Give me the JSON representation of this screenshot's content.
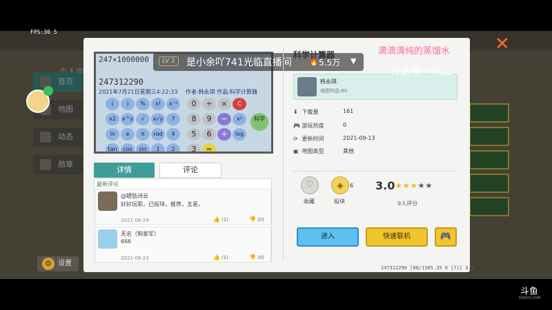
{
  "overlay": {
    "fps": "FPS:30 5",
    "stream": {
      "level": "LV 2",
      "streamer": "是小余吖741光临直播间",
      "viewers": "5.5万"
    },
    "danmu": [
      "滴滴清纯的蒸馏水",
      "在这能一元二"
    ],
    "watermark": "斗鱼",
    "watermark_sub": "DOUYU.COM"
  },
  "background": {
    "panel_title": "个人中心",
    "sidebar": [
      {
        "label": "首页"
      },
      {
        "label": "地图"
      },
      {
        "label": "动态"
      },
      {
        "label": "勋章"
      }
    ],
    "settings_label": "设置"
  },
  "preview": {
    "expr": "247×1000000",
    "result": "247312290",
    "date": "2021年7月21日星期三4:22:33",
    "authors": "作者:韩永琪  作品:科学计算器",
    "keys": [
      "(",
      ")",
      "%",
      "x!",
      "x⁻¹",
      "0",
      "÷",
      "×",
      "C",
      "x2",
      "x^y",
      "√",
      "x√y",
      "7",
      "8",
      "9",
      "−",
      "x³",
      "ln",
      "e",
      "π",
      "rod",
      "4",
      "5",
      "6",
      "+",
      "log",
      "tan",
      "cos",
      "sin",
      "1",
      "2",
      "3",
      "=",
      "科学"
    ]
  },
  "tabs": {
    "detail": "详情",
    "comments": "评论"
  },
  "comments": {
    "heading": "最新评论",
    "items": [
      {
        "name": "@蟋钴诗云",
        "text": "好好玩耶，已投块，推荐，五星。",
        "date": "2021-08-29",
        "likes": "(1)",
        "dislikes": "(0)"
      },
      {
        "name": "无名（狗家军）",
        "text": "666",
        "date": "2021-08-23",
        "likes": "(1)",
        "dislikes": "(0)"
      }
    ]
  },
  "map": {
    "title": "科学计算器",
    "author": "韩永琪",
    "author_works": "地图作品:80",
    "info": [
      {
        "icon": "download-icon",
        "glyph": "⬇",
        "label": "下载量",
        "value": "161"
      },
      {
        "icon": "gamepad-icon",
        "glyph": "🎮",
        "label": "游玩热度",
        "value": "0"
      },
      {
        "icon": "clock-icon",
        "glyph": "⟳",
        "label": "更新时间",
        "value": "2021-09-13"
      },
      {
        "icon": "map-icon",
        "glyph": "▣",
        "label": "地图类型",
        "value": "其他"
      }
    ],
    "favorite_label": "收藏",
    "coin_label": "投块",
    "coin_count": "6",
    "score": "3.0",
    "stars": 3,
    "rating_count": "9人评分"
  },
  "buttons": {
    "enter": "进入",
    "quick_join": "快速联机"
  },
  "status_bar": "247312290    [08/1305.35 0 [7]] 3.3",
  "colors": {
    "tab_active": "#3f9d99",
    "enter_button": "#5dc0f0",
    "quick_button": "#f1c52f",
    "close_x": "#ff6a2b"
  }
}
